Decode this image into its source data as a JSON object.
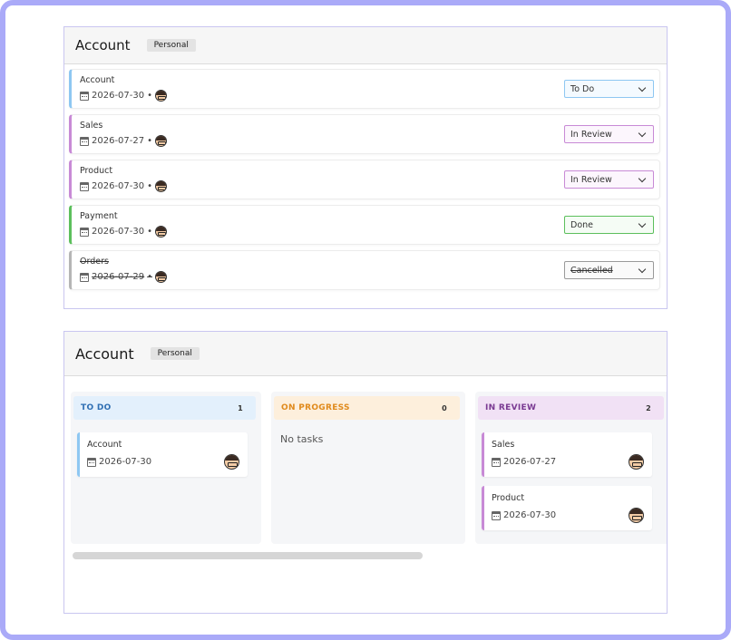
{
  "colors": {
    "frame": "#aaaaf8",
    "todo": "#8ec7f2",
    "review": "#c88ad6",
    "done": "#5cbf5c",
    "cancelled": "#b5b5b5",
    "todo_head_bg": "#e3f0fc",
    "todo_head_text": "#2f6fb3",
    "progress_head_bg": "#fdefdc",
    "progress_head_text": "#e08a1c",
    "review_head_bg": "#f1e1f5",
    "review_head_text": "#7a3a92"
  },
  "list_panel": {
    "title": "Account",
    "tag": "Personal",
    "tasks": [
      {
        "title": "Account",
        "date": "2026-07-30",
        "sep": "•",
        "status": "To Do",
        "avatar": "avatar-icon"
      },
      {
        "title": "Sales",
        "date": "2026-07-27",
        "sep": "•",
        "status": "In Review",
        "avatar": "avatar-icon"
      },
      {
        "title": "Product",
        "date": "2026-07-30",
        "sep": "•",
        "status": "In Review",
        "avatar": "avatar-icon"
      },
      {
        "title": "Payment",
        "date": "2026-07-30",
        "sep": "•",
        "status": "Done",
        "avatar": "avatar-icon"
      },
      {
        "title": "Orders",
        "date": "2026-07-29",
        "sep": "•",
        "status": "Cancelled",
        "avatar": "avatar-icon"
      }
    ]
  },
  "board_panel": {
    "title": "Account",
    "tag": "Personal",
    "columns": [
      {
        "name": "TO DO",
        "count": "1",
        "cards": [
          {
            "title": "Account",
            "date": "2026-07-30"
          }
        ]
      },
      {
        "name": "ON PROGRESS",
        "count": "0",
        "empty_text": "No tasks"
      },
      {
        "name": "IN REVIEW",
        "count": "2",
        "cards": [
          {
            "title": "Sales",
            "date": "2026-07-27"
          },
          {
            "title": "Product",
            "date": "2026-07-30"
          }
        ]
      }
    ]
  }
}
